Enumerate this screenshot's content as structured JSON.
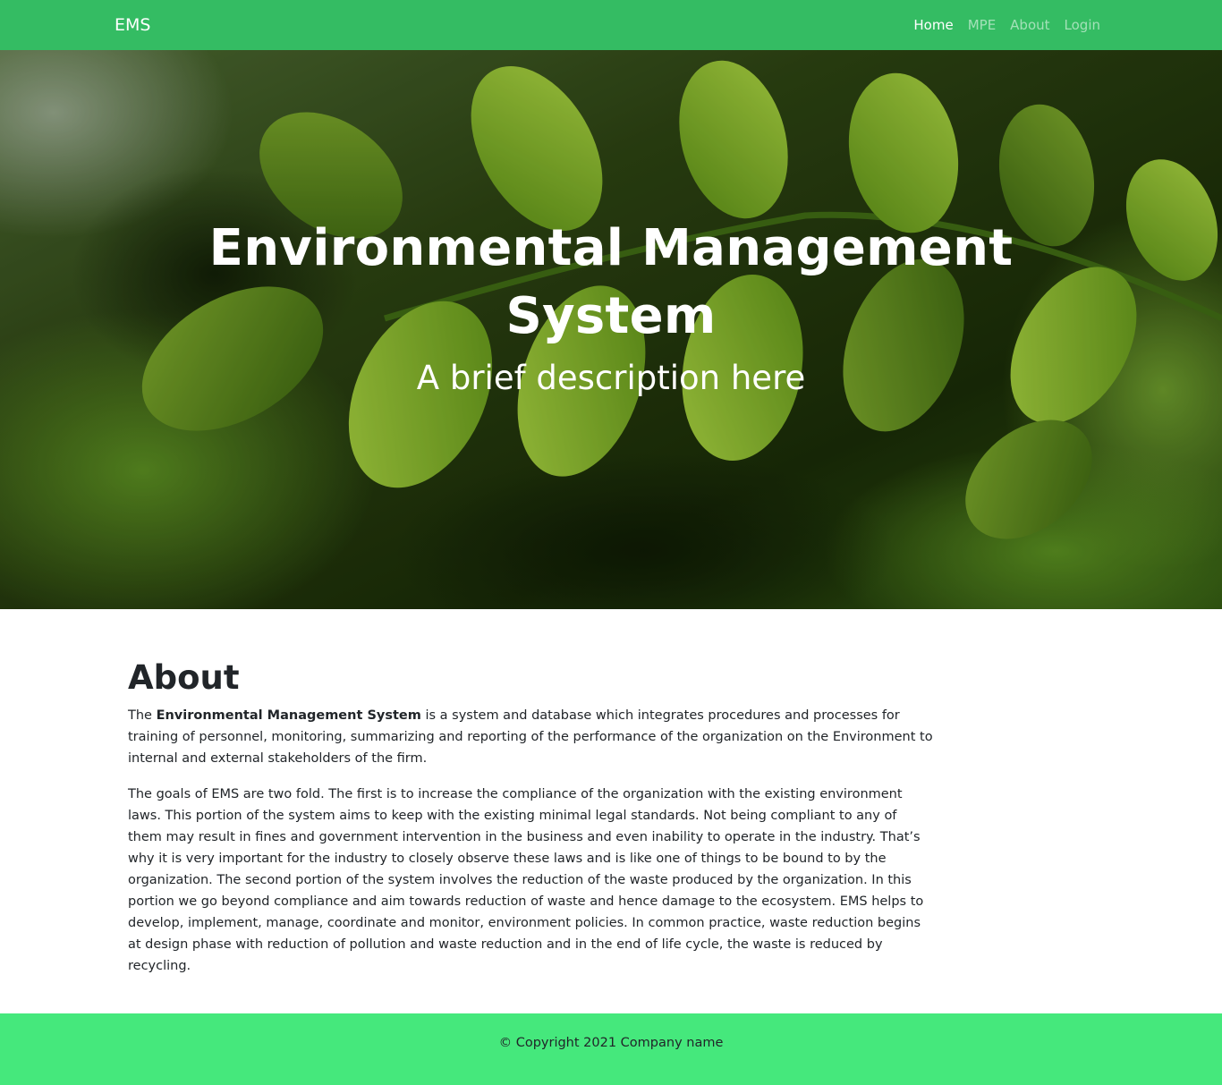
{
  "navbar": {
    "brand": "EMS",
    "links": [
      {
        "label": "Home",
        "active": true
      },
      {
        "label": "MPE",
        "active": false
      },
      {
        "label": "About",
        "active": false
      },
      {
        "label": "Login",
        "active": false
      }
    ],
    "color": "#34bc63"
  },
  "hero": {
    "title": "Environmental Management System",
    "subtitle": "A brief description here",
    "background": "green leaves photo"
  },
  "about": {
    "heading": "About",
    "p1_prefix": "The ",
    "p1_bold": "Environmental Management System",
    "p1_rest": " is a system and database which integrates procedures and processes for training of personnel, monitoring, summarizing and reporting of the performance of the organization on the Environment to internal and external stakeholders of the firm.",
    "p2": "The goals of EMS are two fold. The first is to increase the compliance of the organization with the existing environment laws. This portion of the system aims to keep with the existing minimal legal standards. Not being compliant to any of them may result in fines and government intervention in the business and even inability to operate in the industry. That’s why it is very important for the industry to closely observe these laws and is like one of things to be bound to by the organization. The second portion of the system involves the reduction of the waste produced by the organization. In this portion we go beyond compliance and aim towards reduction of waste and hence damage to the ecosystem. EMS helps to develop, implement, manage, coordinate and monitor, environment policies. In common practice, waste reduction begins at design phase with reduction of pollution and waste reduction and in the end of life cycle, the waste is reduced by recycling."
  },
  "footer": {
    "text": "© Copyright 2021 Company name",
    "color": "#45e87c"
  }
}
